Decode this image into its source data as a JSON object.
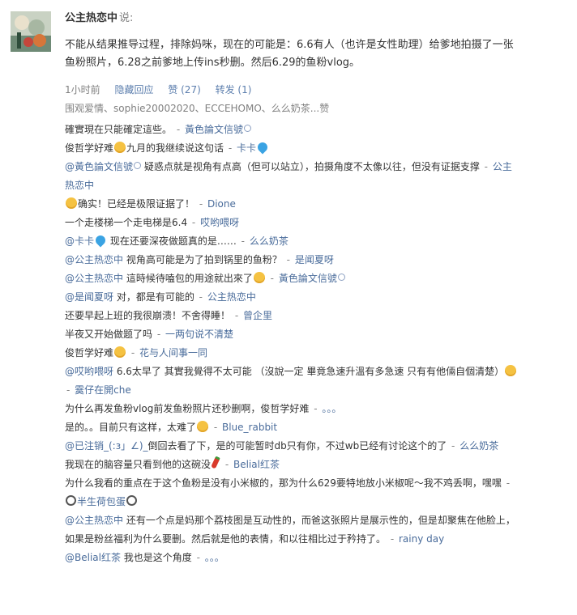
{
  "post": {
    "author": "公主热恋中",
    "said": "说:",
    "text": "不能从结果推导过程，排除妈咪，现在的可能是：6.6有人（也许是女性助理）给爹地拍摄了一张鱼粉照片，6.28之前爹地上传ins秒删。然后6.29的鱼粉vlog。",
    "time": "1小时前",
    "actions": {
      "hide": "隐藏回应",
      "like": "赞 (27)",
      "repost": "转发 (1)"
    },
    "likers": "围观爱情、sophie20002020、ECCEHOMO、么么奶茶...赞"
  },
  "comments": [
    {
      "pre": "",
      "mention": "",
      "text": "確實現在只能確定這些。",
      "user": "黃色論文信號",
      "badge": true,
      "emoji": "",
      "emoji_pos": ""
    },
    {
      "pre": "",
      "mention": "",
      "text": "俊哲学好难",
      "text2": "九月的我继续说这句话",
      "emoji": "face",
      "emoji_pos": "mid",
      "user": "卡卡",
      "user_icon": "blue"
    },
    {
      "pre": "",
      "mention": "@黃色論文信號",
      "mention_badge": true,
      "text": " 疑惑点就是视角有点高（但可以站立），拍摄角度不太像以往，但没有证据支撑",
      "user": "公主热恋中"
    },
    {
      "pre": "",
      "mention": "",
      "text": "确实！已经是极限证据了！",
      "emoji": "face",
      "emoji_pos": "start",
      "user": "Dione"
    },
    {
      "pre": "",
      "mention": "",
      "text": "一个走楼梯一个走电梯是6.4",
      "user": "哎哟喂呀"
    },
    {
      "pre": "",
      "mention": "@卡卡",
      "mention_icon": "blue",
      "text": " 现在还要深夜做题真的是……",
      "user": "么么奶茶"
    },
    {
      "pre": "",
      "mention": "@公主热恋中",
      "text": " 视角高可能是为了拍到锅里的鱼粉？",
      "user": "是闻夏呀"
    },
    {
      "pre": "",
      "mention": "@公主热恋中",
      "text": " 這時候待嗑包的用途就出來了",
      "emoji": "face",
      "emoji_pos": "end",
      "user": "黃色論文信號",
      "badge": true
    },
    {
      "pre": "",
      "mention": "@是闻夏呀",
      "text": " 对，都是有可能的",
      "user": "公主热恋中"
    },
    {
      "pre": "",
      "mention": "",
      "text": "还要早起上班的我很崩溃！不舍得睡！",
      "user": "曾企里"
    },
    {
      "pre": "",
      "mention": "",
      "text": "半夜又开始做题了吗",
      "user": "一两句说不清楚"
    },
    {
      "pre": "",
      "mention": "",
      "text": "俊哲学好难",
      "emoji": "face",
      "emoji_pos": "end",
      "user": "花与人间事一同"
    },
    {
      "pre": "",
      "mention": "@哎哟喂呀",
      "text": " 6.6太早了 其實我覺得不太可能 （沒說一定 畢竟急速升溫有多急速 只有有他倆自個清楚）",
      "emoji": "face",
      "emoji_pos": "end",
      "user": "霙仔在開che"
    },
    {
      "pre": "",
      "mention": "",
      "text": "为什么再发鱼粉vlog前发鱼粉照片还秒删啊，俊哲学好难",
      "user": "。。。"
    },
    {
      "pre": "",
      "mention": "",
      "text": "是的。。目前只有这样，太难了",
      "emoji": "face",
      "emoji_pos": "end",
      "user": "Blue_rabbit"
    },
    {
      "pre": "",
      "mention": "@已注销_(:з」∠)_",
      "text": "倒回去看了下，是的可能暂时db只有你，不过wb已经有讨论这个的了",
      "user": "么么奶茶"
    },
    {
      "pre": "",
      "mention": "",
      "text": "我现在的脑容量只看到他的这碗没",
      "emoji": "chili",
      "emoji_pos": "end",
      "user": "Belial红茶"
    },
    {
      "pre": "",
      "mention": "",
      "text": "为什么我看的重点在于这个鱼粉是没有小米椒的，那为什么629要特地放小米椒呢～我不鸡丢啊，嘿嘿",
      "user": "半生荷包蛋",
      "user_mag": true
    },
    {
      "pre": "",
      "mention": "@公主热恋中",
      "text": " 还有一个点是妈那个荔枝图是互动性的，而爸这张照片是展示性的，但是却聚焦在他脸上，如果是粉丝福利为什么要删。然后就是他的表情，和以往相比过于矜持了。",
      "user": "rainy day"
    },
    {
      "pre": "",
      "mention": "@Belial红茶",
      "text": " 我也是这个角度",
      "user": "。。。"
    }
  ]
}
